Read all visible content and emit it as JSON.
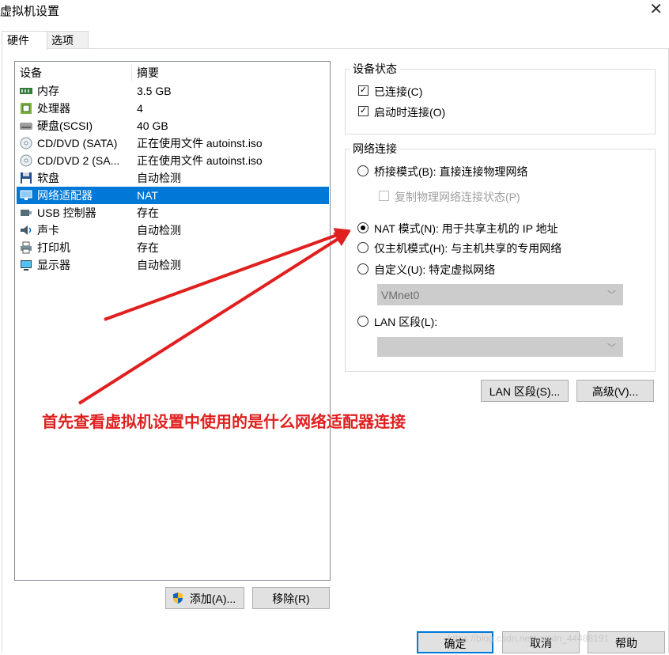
{
  "window": {
    "title": "虚拟机设置"
  },
  "tabs": [
    {
      "label": "硬件"
    },
    {
      "label": "选项"
    }
  ],
  "device_list": {
    "headers": {
      "device": "设备",
      "summary": "摘要"
    },
    "rows": [
      {
        "name": "内存",
        "summary": "3.5 GB",
        "icon": "memory-icon"
      },
      {
        "name": "处理器",
        "summary": "4",
        "icon": "processor-icon"
      },
      {
        "name": "硬盘(SCSI)",
        "summary": "40 GB",
        "icon": "hard-disk-icon"
      },
      {
        "name": "CD/DVD (SATA)",
        "summary": "正在使用文件 autoinst.iso",
        "icon": "cd-dvd-icon"
      },
      {
        "name": "CD/DVD 2 (SA...",
        "summary": "正在使用文件 autoinst.iso",
        "icon": "cd-dvd-icon"
      },
      {
        "name": "软盘",
        "summary": "自动检测",
        "icon": "floppy-icon"
      },
      {
        "name": "网络适配器",
        "summary": "NAT",
        "icon": "network-adapter-icon"
      },
      {
        "name": "USB 控制器",
        "summary": "存在",
        "icon": "usb-icon"
      },
      {
        "name": "声卡",
        "summary": "自动检测",
        "icon": "sound-card-icon"
      },
      {
        "name": "打印机",
        "summary": "存在",
        "icon": "printer-icon"
      },
      {
        "name": "显示器",
        "summary": "自动检测",
        "icon": "display-icon"
      }
    ],
    "selected_index": 6
  },
  "list_buttons": {
    "add": "添加(A)...",
    "remove": "移除(R)"
  },
  "device_status": {
    "title": "设备状态",
    "connected": {
      "label": "已连接(C)",
      "checked": true
    },
    "connect_at_power_on": {
      "label": "启动时连接(O)",
      "checked": true
    }
  },
  "network": {
    "title": "网络连接",
    "bridged": {
      "label": "桥接模式(B): 直接连接物理网络",
      "selected": false
    },
    "replicate": {
      "label": "复制物理网络连接状态(P)",
      "checked": false
    },
    "nat": {
      "label": "NAT 模式(N): 用于共享主机的 IP 地址",
      "selected": true
    },
    "host_only": {
      "label": "仅主机模式(H): 与主机共享的专用网络",
      "selected": false
    },
    "custom": {
      "label": "自定义(U): 特定虚拟网络",
      "selected": false
    },
    "custom_select": "VMnet0",
    "lan_segment": {
      "label": "LAN 区段(L):",
      "selected": false
    },
    "lan_select": ""
  },
  "network_buttons": {
    "lan_segments": "LAN 区段(S)...",
    "advanced": "高级(V)..."
  },
  "dialog_buttons": {
    "ok": "确定",
    "cancel": "取消",
    "help": "帮助"
  },
  "annotation": {
    "text": "首先查看虚拟机设置中使用的是什么网络适配器连接",
    "color": "#e0201f"
  },
  "watermark": "https://blog.csdn.net/weixin_44488191",
  "colors": {
    "selection": "#0078d7",
    "arrow": "#e0201f"
  }
}
